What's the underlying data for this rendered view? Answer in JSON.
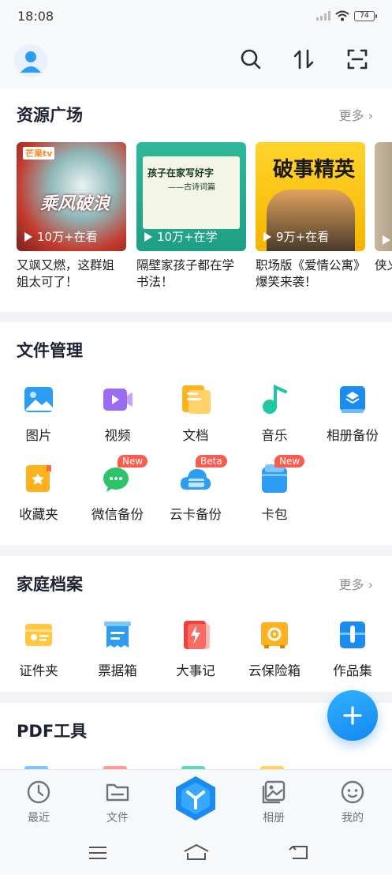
{
  "status": {
    "time": "18:08",
    "battery": "74"
  },
  "header": {
    "icons": [
      "avatar",
      "search-icon",
      "sort-icon",
      "scan-icon"
    ]
  },
  "resources": {
    "title": "资源广场",
    "more": "更多",
    "items": [
      {
        "views": "10万+在看",
        "caption": "又飒又燃，这群姐姐太可了！",
        "overlay": "乘风破浪",
        "logo": "芒果tv"
      },
      {
        "views": "10万+在学",
        "caption": "隔壁家孩子都在学书法！",
        "overlay": "孩子在家写好字",
        "sub": "——古诗词篇"
      },
      {
        "views": "9万+在看",
        "caption": "职场版《爱情公寓》爆笑来袭！",
        "overlay": "破事精英"
      },
      {
        "views": "",
        "caption": "侠义出！",
        "overlay": ""
      }
    ]
  },
  "files": {
    "title": "文件管理",
    "items": [
      {
        "label": "图片",
        "icon": "image-icon"
      },
      {
        "label": "视频",
        "icon": "video-icon"
      },
      {
        "label": "文档",
        "icon": "document-icon"
      },
      {
        "label": "音乐",
        "icon": "music-icon"
      },
      {
        "label": "相册备份",
        "icon": "album-backup-icon"
      },
      {
        "label": "收藏夹",
        "icon": "favorites-icon"
      },
      {
        "label": "微信备份",
        "icon": "wechat-backup-icon",
        "badge": "New"
      },
      {
        "label": "云卡备份",
        "icon": "cloud-card-backup-icon",
        "badge": "Beta"
      },
      {
        "label": "卡包",
        "icon": "card-wallet-icon",
        "badge": "New"
      }
    ]
  },
  "family": {
    "title": "家庭档案",
    "more": "更多",
    "items": [
      {
        "label": "证件夹",
        "icon": "id-folder-icon"
      },
      {
        "label": "票据箱",
        "icon": "receipt-box-icon"
      },
      {
        "label": "大事记",
        "icon": "milestone-icon"
      },
      {
        "label": "云保险箱",
        "icon": "cloud-safe-icon"
      },
      {
        "label": "作品集",
        "icon": "portfolio-icon"
      }
    ]
  },
  "pdf": {
    "title": "PDF工具"
  },
  "tabs": [
    {
      "label": "最近",
      "icon": "clock-icon"
    },
    {
      "label": "文件",
      "icon": "folder-icon"
    },
    {
      "label": "",
      "icon": "center-logo-icon"
    },
    {
      "label": "相册",
      "icon": "photo-album-icon"
    },
    {
      "label": "我的",
      "icon": "profile-face-icon"
    }
  ],
  "colors": {
    "accent": "#1a8cf0",
    "badge": "#ff5a4e"
  }
}
